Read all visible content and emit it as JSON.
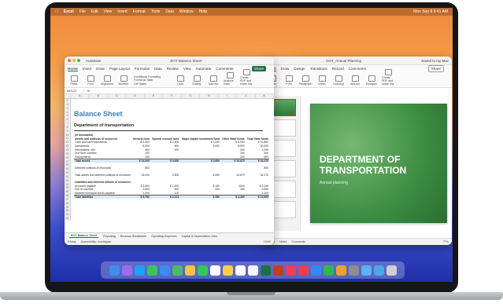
{
  "menubar": {
    "app": "Excel",
    "items": [
      "File",
      "Edit",
      "View",
      "Insert",
      "Format",
      "Tools",
      "Data",
      "Window",
      "Help"
    ],
    "clock": "Mon Sep 8  9:41 AM"
  },
  "excel": {
    "title": "BOT Balance Sheet",
    "autosave": "AutoSave",
    "tabs": [
      "Home",
      "Insert",
      "Draw",
      "Page Layout",
      "Formulas",
      "Data",
      "Review",
      "View",
      "Automate"
    ],
    "active_tab": "Home",
    "comments": "Comments",
    "share": "Share",
    "ribbon": [
      "Paste",
      "Font",
      "Alignment",
      "Number",
      "Conditional Formatting",
      "Format as Table",
      "Cell Styles",
      "Cells",
      "Editing",
      "Add-ins",
      "Analyze Data",
      "Create PDF and share link"
    ],
    "name_box": "AD122",
    "fx": "fx",
    "columns": [
      "A",
      "B",
      "C",
      "D",
      "E",
      "F",
      "G",
      "H",
      "I",
      "J",
      "K"
    ],
    "sheet_title": "Balance Sheet",
    "sheet_subtitle": "Department of transportation",
    "rows": [
      {
        "label": "(in thousands)",
        "c1": "",
        "c2": "",
        "c3": "",
        "c4": "",
        "c5": "",
        "bold": true
      },
      {
        "label": "Assets and outflows of resources",
        "c1": "General fund",
        "c2": "Special revenue fund",
        "c3": "Major capital investment fund",
        "c4": "Other State funds",
        "c5": "Total State funds",
        "bold": true
      },
      {
        "label": "Cash and cash equivalents",
        "c1": "$ 3,400",
        "c2": "$ 2,400",
        "c3": "$ 1,000",
        "c4": "$ 6,000",
        "c5": "$ 12,800",
        "bold": false
      },
      {
        "label": "Investments",
        "c1": "8,000",
        "c2": "800",
        "c3": "3,600",
        "c4": "8,000",
        "c5": "20,400",
        "bold": false
      },
      {
        "label": "Receivables, Net",
        "c1": "500",
        "c2": "200",
        "c3": "",
        "c4": "300",
        "c5": "1,000",
        "bold": false
      },
      {
        "label": "Due from counties",
        "c1": "200",
        "c2": "",
        "c3": "",
        "c4": "200",
        "c5": "400",
        "bold": false
      },
      {
        "label": "Prepayments",
        "c1": "300",
        "c2": "",
        "c3": "",
        "c4": "200",
        "c5": "600",
        "bold": false
      },
      {
        "label": "Total assets",
        "c1": "$ 14,000",
        "c2": "$ 3,500",
        "c3": "$ 4,600",
        "c4": "$ 10,670",
        "c5": "$ 34,370",
        "total": true
      },
      {
        "label": "",
        "c1": "",
        "c2": "",
        "c3": "",
        "c4": "",
        "c5": "",
        "bold": false
      },
      {
        "label": "Deferred outflows of resources",
        "c1": "800",
        "c2": "",
        "c3": "",
        "c4": "",
        "c5": "800",
        "bold": false
      },
      {
        "label": "",
        "c1": "",
        "c2": "",
        "c3": "",
        "c4": "",
        "c5": "",
        "bold": false
      },
      {
        "label": "Total assets and deferred outflows of resources",
        "c1": "15,400",
        "c2": "3,500",
        "c3": "4,600",
        "c4": "10,670",
        "c5": "34,170",
        "bold": false
      },
      {
        "label": "",
        "c1": "",
        "c2": "",
        "c3": "",
        "c4": "",
        "c5": "",
        "bold": false
      },
      {
        "label": "Liabilities and deferred inflows of resources",
        "c1": "",
        "c2": "",
        "c3": "",
        "c4": "",
        "c5": "",
        "bold": true
      },
      {
        "label": "Accounts payable",
        "c1": "$ 3,600",
        "c2": "$ 1,600",
        "c3": "$ 150",
        "c4": "4000",
        "c5": "$ 9,100",
        "bold": false
      },
      {
        "label": "Due to counties",
        "c1": "2,600",
        "c2": "500",
        "c3": "200",
        "c4": "400",
        "c5": "3,500",
        "bold": false
      },
      {
        "label": "Matured municipal bonds payable",
        "c1": "1,000",
        "c2": "100",
        "c3": "",
        "c4": "",
        "c5": "1,100",
        "bold": false
      },
      {
        "label": "Total liabilities",
        "c1": "$ 5,760",
        "c2": "$ 2,101",
        "c3": "$ 350",
        "c4": "$ 4,400",
        "c5": "$ 12,600",
        "total": true
      }
    ],
    "sheet_tabs": [
      "BOT Balance Sheet",
      "Reporting",
      "Revenue Breakdown",
      "Operating Expenses",
      "Capital & Depreciation, Infra"
    ],
    "active_sheet": "BOT Balance Sheet",
    "status_left": "Ready",
    "accessibility": "Accessibility: Investigate",
    "zoom": "104%"
  },
  "powerpoint": {
    "title": "DOT_Annual Planning",
    "saved": "Saved to my Mac",
    "tabs": [
      "Insert",
      "Draw",
      "Design",
      "Transitions"
    ],
    "record": "Record",
    "comments": "Comments",
    "share": "Share",
    "ribbon": [
      "Slides",
      "Font",
      "Paragraph",
      "Insert",
      "Drawing",
      "Add-ins",
      "Designer",
      "Create PDF and share link"
    ],
    "slide_title": "DEPARTMENT OF TRANSPORTATION",
    "slide_subtitle": "Annual planning",
    "slide_counter": "1 of 15",
    "notes": "Notes",
    "comments_status": "Comments",
    "zoom": "77%"
  },
  "dock": {
    "apps": [
      "finder-icon",
      "launchpad-icon",
      "safari-icon",
      "messages-icon",
      "mail-icon",
      "maps-icon",
      "photos-icon",
      "facetime-icon",
      "calendar-icon",
      "notes-icon",
      "reminders-icon",
      "freeform-icon",
      "excel-icon",
      "powerpoint-icon",
      "music-icon",
      "news-icon",
      "appstore-icon",
      "numbers-icon",
      "pages-icon",
      "settings-icon",
      "preview-icon",
      "downloads-icon",
      "trash-icon"
    ],
    "colors": [
      "#3b8ef0",
      "#9b6cf0",
      "#1fa0f5",
      "#34c759",
      "#3a8df0",
      "#4cb96b",
      "#f4c542",
      "#34c759",
      "#ffffff",
      "#f7d04a",
      "#ffffff",
      "#f5f5f5",
      "#1e7145",
      "#c43e1c",
      "#f53c5a",
      "#f23b4c",
      "#2f8cf5",
      "#2fb84d",
      "#f0a030",
      "#8e8e93",
      "#5ab3f0",
      "#4aa7e8",
      "#d0d0d0"
    ]
  }
}
